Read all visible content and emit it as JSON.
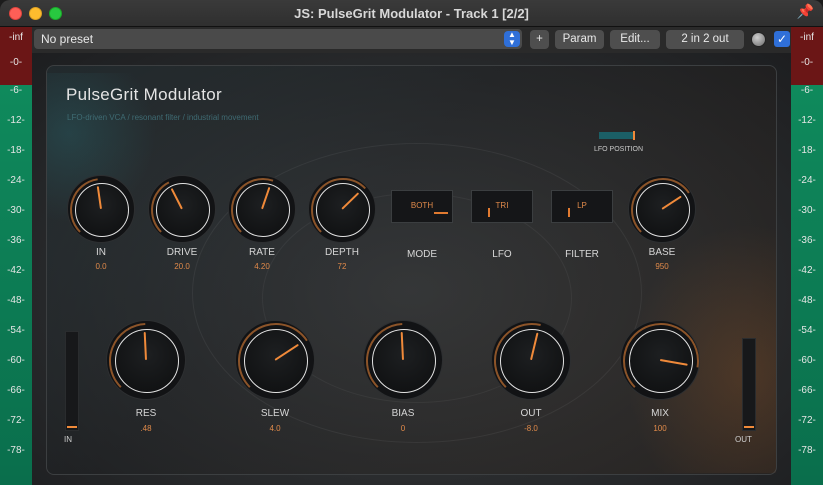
{
  "window": {
    "title": "JS: PulseGrit Modulator - Track 1 [2/2]"
  },
  "toolbar": {
    "preset": "No preset",
    "plus_label": "+",
    "param_label": "Param",
    "edit_label": "Edit...",
    "io_label": "2 in 2 out",
    "enabled_checked": true
  },
  "meter_ticks": [
    "-inf",
    "-0-",
    "-6-",
    "-12-",
    "-18-",
    "-24-",
    "-30-",
    "-36-",
    "-42-",
    "-48-",
    "-54-",
    "-60-",
    "-66-",
    "-72-",
    "-78-"
  ],
  "plugin": {
    "title": "PulseGrit Modulator",
    "subtitle": "LFO-driven VCA / resonant filter / industrial movement",
    "lfo_position_label": "LFO POSITION",
    "lfo_position_value": 1.0,
    "in_meter_label": "IN",
    "out_meter_label": "OUT"
  },
  "knobs": [
    {
      "name": "in",
      "label": "IN",
      "value": "0.0",
      "norm": 0.47
    },
    {
      "name": "drive",
      "label": "DRIVE",
      "value": "20.0",
      "norm": 0.4
    },
    {
      "name": "rate",
      "label": "RATE",
      "value": "4.20",
      "norm": 0.57
    },
    {
      "name": "depth",
      "label": "DEPTH",
      "value": "72",
      "norm": 0.67
    },
    {
      "name": "base",
      "label": "BASE",
      "value": "950",
      "norm": 0.71
    },
    {
      "name": "res",
      "label": "RES",
      "value": ".48",
      "norm": 0.49
    },
    {
      "name": "slew",
      "label": "SLEW",
      "value": "4.0",
      "norm": 0.71
    },
    {
      "name": "bias",
      "label": "BIAS",
      "value": "0",
      "norm": 0.49
    },
    {
      "name": "out",
      "label": "OUT",
      "value": "-8.0",
      "norm": 0.55
    },
    {
      "name": "mix",
      "label": "MIX",
      "value": "100",
      "norm": 0.87
    }
  ],
  "selectors": [
    {
      "name": "mode",
      "label": "MODE",
      "value": "BOTH",
      "position": 1.0
    },
    {
      "name": "lfo",
      "label": "LFO",
      "value": "TRI",
      "position": 0.0
    },
    {
      "name": "filter",
      "label": "FILTER",
      "value": "LP",
      "position": 0.0
    }
  ],
  "colors": {
    "accent": "#f08a3a",
    "meter_green": "#0f8a5c",
    "meter_red": "#6b1616",
    "toolbar_blue": "#2f6fd8"
  }
}
